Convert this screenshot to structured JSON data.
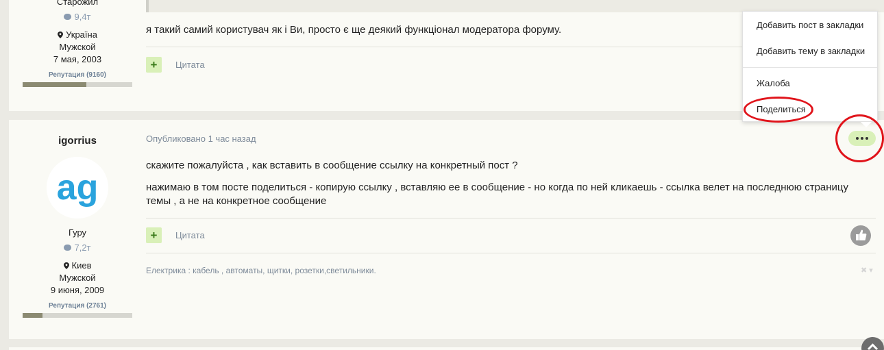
{
  "post1": {
    "author_rank": "Старожил",
    "posts_count": "9,4т",
    "location": "Україна",
    "gender": "Мужской",
    "joined": "7 мая, 2003",
    "reputation": "Репутация (9160)",
    "reputation_fill_percent": 58,
    "message": "я такий самий користувач як і Ви, просто є ще деякий функціонал модератора форуму.",
    "quote_label": "Цитата"
  },
  "post2": {
    "author_name": "igorrius",
    "avatar_text": "ag",
    "author_rank": "Гуру",
    "posts_count": "7,2т",
    "location": "Киев",
    "gender": "Мужской",
    "joined": "9 июня, 2009",
    "reputation": "Репутация (2761)",
    "reputation_fill_percent": 18,
    "published": "Опубликовано 1 час назад",
    "message_line1": "скажите пожалуйста , как вставить в сообщение ссылку на конкретный пост ?",
    "message_line2": "нажимаю в том посте поделиться - копирую ссылку , вставляю ее в сообщение - но когда по ней кликаешь - ссылка велет на последнюю страницу темы , а не на конкретное сообщение",
    "quote_label": "Цитата",
    "signature": "Електрика : кабель , автоматы, щитки, розетки,светильники."
  },
  "menu": {
    "items": [
      "Добавить пост в закладки",
      "Добавить тему в закладки",
      "Жалоба",
      "Поделиться"
    ]
  },
  "colors": {
    "accent_green": "#d9f0b8",
    "highlight_red": "#e0141b",
    "muted_text": "#7d8a99"
  }
}
